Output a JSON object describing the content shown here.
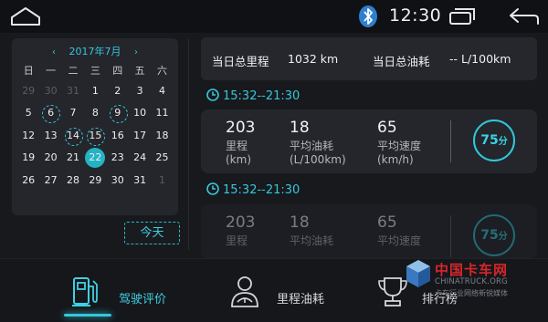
{
  "status_bar": {
    "time": "12:30",
    "icons": [
      "home-icon",
      "bluetooth-icon",
      "recent-apps-icon",
      "back-icon"
    ]
  },
  "calendar": {
    "prev_arrow": "‹",
    "next_arrow": "›",
    "month_label": "2017年7月",
    "weekdays": [
      "日",
      "一",
      "二",
      "三",
      "四",
      "五",
      "六"
    ],
    "weeks": [
      [
        "29",
        "30",
        "31",
        "1",
        "2",
        "3",
        "4"
      ],
      [
        "5",
        "6",
        "7",
        "8",
        "9",
        "10",
        "11"
      ],
      [
        "12",
        "13",
        "14",
        "15",
        "16",
        "17",
        "18"
      ],
      [
        "19",
        "20",
        "21",
        "22",
        "23",
        "24",
        "25"
      ],
      [
        "26",
        "27",
        "28",
        "29",
        "30",
        "31",
        "1"
      ]
    ],
    "selected_day": "22",
    "marked_days": [
      "6",
      "9",
      "14",
      "15"
    ],
    "today_label": "今天"
  },
  "summary": {
    "mileage_label": "当日总里程",
    "mileage_value": "1032 km",
    "fuel_label": "当日总油耗",
    "fuel_value": "-- L/100km"
  },
  "trips": [
    {
      "time_range": "15:32--21:30",
      "distance": "203",
      "distance_label": "里程",
      "distance_unit": "(km)",
      "avg_fuel": "18",
      "avg_fuel_label": "平均油耗",
      "avg_fuel_unit": "(L/100km)",
      "avg_speed": "65",
      "avg_speed_label": "平均速度",
      "avg_speed_unit": "(km/h)",
      "score": "75",
      "score_unit": "分"
    },
    {
      "time_range": "15:32--21:30",
      "distance": "203",
      "distance_label": "里程",
      "avg_fuel": "18",
      "avg_fuel_label": "平均油耗",
      "avg_speed": "65",
      "avg_speed_label": "平均速度",
      "score": "75",
      "score_unit": "分"
    }
  ],
  "bottom_nav": {
    "items": [
      {
        "label": "驾驶评价",
        "icon": "fuel-pump-icon",
        "active": true
      },
      {
        "label": "里程油耗",
        "icon": "driver-icon",
        "active": false
      },
      {
        "label": "排行榜",
        "icon": "trophy-icon",
        "active": false
      }
    ]
  },
  "watermark": {
    "cn": "中国卡车网",
    "en": "CHINATRUCK.ORG",
    "slogan": "卡车行业网络新锐媒体"
  },
  "colors": {
    "accent": "#31c8dc",
    "background": "#17191d",
    "card": "#24262b",
    "watermark_red": "#d6262a"
  }
}
